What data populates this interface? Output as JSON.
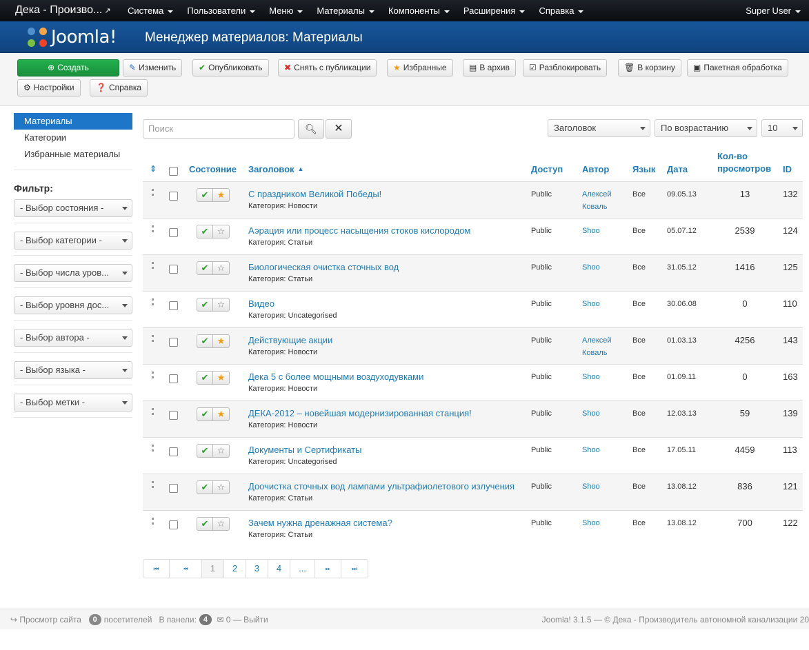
{
  "navbar": {
    "site_name": "Дека - Произво...",
    "menu": [
      "Система",
      "Пользователи",
      "Меню",
      "Материалы",
      "Компоненты",
      "Расширения",
      "Справка"
    ],
    "user": "Super User"
  },
  "header": {
    "logo_text": "Joomla!",
    "title": "Менеджер материалов: Материалы"
  },
  "toolbar": {
    "create": "Создать",
    "edit": "Изменить",
    "publish": "Опубликовать",
    "unpublish": "Снять с публикации",
    "featured": "Избранные",
    "archive": "В архив",
    "checkin": "Разблокировать",
    "trash": "В корзину",
    "batch": "Пакетная обработка",
    "options": "Настройки",
    "help": "Справка"
  },
  "sidebar": {
    "items": [
      "Материалы",
      "Категории",
      "Избранные материалы"
    ],
    "filter_label": "Фильтр:",
    "filters": [
      "- Выбор состояния -",
      "- Выбор категории -",
      "- Выбор числа уров...",
      "- Выбор уровня дос...",
      "- Выбор автора -",
      "- Выбор языка -",
      "- Выбор метки -"
    ]
  },
  "search": {
    "placeholder": "Поиск"
  },
  "list_controls": {
    "order_by": "Заголовок",
    "direction": "По возрастанию",
    "limit": "10"
  },
  "table": {
    "headers": {
      "status": "Состояние",
      "title": "Заголовок",
      "access": "Доступ",
      "author": "Автор",
      "language": "Язык",
      "date": "Дата",
      "hits_line1": "Кол-во",
      "hits_line2": "просмотров",
      "id": "ID"
    },
    "rows": [
      {
        "title": "С праздником Великой Победы!",
        "category": "Категория: Новости",
        "access": "Public",
        "author1": "Алексей",
        "author2": "Коваль",
        "lang": "Все",
        "date": "09.05.13",
        "hits": "13",
        "id": "132",
        "featured": true
      },
      {
        "title": "Аэрация или процесс насыщения стоков кислородом",
        "category": "Категория: Статьи",
        "access": "Public",
        "author1": "Shoo",
        "author2": "",
        "lang": "Все",
        "date": "05.07.12",
        "hits": "2539",
        "id": "124",
        "featured": false
      },
      {
        "title": "Биологическая очистка сточных вод",
        "category": "Категория: Статьи",
        "access": "Public",
        "author1": "Shoo",
        "author2": "",
        "lang": "Все",
        "date": "31.05.12",
        "hits": "1416",
        "id": "125",
        "featured": false
      },
      {
        "title": "Видео",
        "category": "Категория: Uncategorised",
        "access": "Public",
        "author1": "Shoo",
        "author2": "",
        "lang": "Все",
        "date": "30.06.08",
        "hits": "0",
        "id": "110",
        "featured": false
      },
      {
        "title": "Действующие акции",
        "category": "Категория: Новости",
        "access": "Public",
        "author1": "Алексей",
        "author2": "Коваль",
        "lang": "Все",
        "date": "01.03.13",
        "hits": "4256",
        "id": "143",
        "featured": true
      },
      {
        "title": "Дека 5 с более мощными воздуходувками",
        "category": "Категория: Новости",
        "access": "Public",
        "author1": "Shoo",
        "author2": "",
        "lang": "Все",
        "date": "01.09.11",
        "hits": "0",
        "id": "163",
        "featured": true
      },
      {
        "title": "ДЕКА-2012 – новейшая модернизированная станция!",
        "category": "Категория: Новости",
        "access": "Public",
        "author1": "Shoo",
        "author2": "",
        "lang": "Все",
        "date": "12.03.13",
        "hits": "59",
        "id": "139",
        "featured": true
      },
      {
        "title": "Документы и Сертификаты",
        "category": "Категория: Uncategorised",
        "access": "Public",
        "author1": "Shoo",
        "author2": "",
        "lang": "Все",
        "date": "17.05.11",
        "hits": "4459",
        "id": "113",
        "featured": false
      },
      {
        "title": "Доочистка сточных вод лампами ультрафиолетового излучения",
        "category": "Категория: Статьи",
        "access": "Public",
        "author1": "Shoo",
        "author2": "",
        "lang": "Все",
        "date": "13.08.12",
        "hits": "836",
        "id": "121",
        "featured": false
      },
      {
        "title": "Зачем нужна дренажная система?",
        "category": "Категория: Статьи",
        "access": "Public",
        "author1": "Shoo",
        "author2": "",
        "lang": "Все",
        "date": "13.08.12",
        "hits": "700",
        "id": "122",
        "featured": false
      }
    ]
  },
  "pagination": {
    "pages": [
      "1",
      "2",
      "3",
      "4",
      "..."
    ],
    "current": "1"
  },
  "footer": {
    "view_site": "Просмотр сайта",
    "visitors_count": "0",
    "visitors_label": "посетителей",
    "admin_label": "В панели:",
    "admin_count": "4",
    "messages_count": "0",
    "logout": "Выйти",
    "copyright": "Joomla! 3.1.5 — © Дека - Производитель автономной канализации 20"
  },
  "colors": {
    "accent": "#1d76c8",
    "header": "#10447e",
    "create_button": "#1a8f3c",
    "published_check": "#2ca02c",
    "featured_star": "#f39c12"
  }
}
